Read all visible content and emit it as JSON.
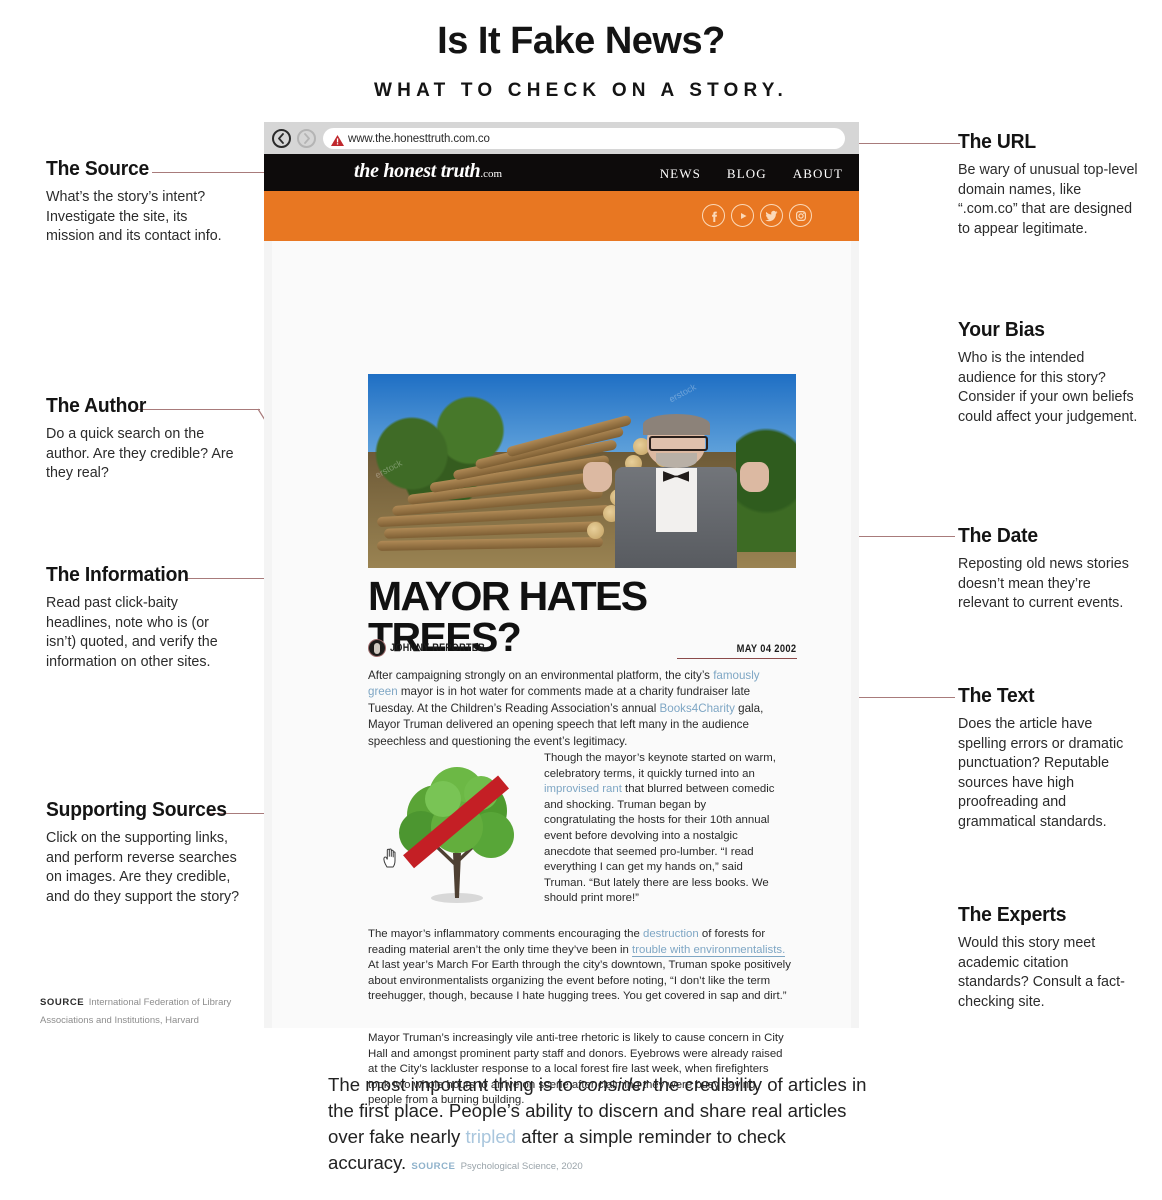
{
  "header": {
    "title": "Is It Fake News?",
    "subtitle": "WHAT TO CHECK ON A STORY."
  },
  "browser": {
    "url": "www.the.honesttruth.com.co",
    "back_icon": "back-arrow-icon",
    "forward_icon": "forward-arrow-icon",
    "warning_icon": "warning-triangle-icon",
    "site": {
      "logo": "the honest truth",
      "logo_suffix": ".com",
      "nav": [
        "NEWS",
        "BLOG",
        "ABOUT"
      ],
      "socials": [
        "facebook-icon",
        "youtube-icon",
        "twitter-icon",
        "instagram-icon"
      ]
    },
    "article": {
      "headline": "MAYOR HATES TREES?",
      "author": "JOHNNY REPORTER",
      "date": "MAY 04 2002",
      "lead_1": "After campaigning strongly on an environmental platform, the city’s ",
      "lead_link_1": "famously green",
      "lead_2": " mayor is in hot water for comments made at a charity fundraiser late Tuesday. At the Children’s Reading Association’s annual ",
      "lead_link_2": "Books4Charity",
      "lead_3": " gala, Mayor Truman delivered an opening speech that left many in the audience speechless and questioning the event’s legitimacy.",
      "col_1": "Though the mayor’s keynote started on warm, celebratory terms, it quickly turned into an ",
      "col_link": "improvised rant",
      "col_2": " that blurred between comedic and shocking. Truman began by congratulating the hosts for their 10th annual event before devolving into a nostalgic anecdote that seemed pro-lumber. “I read everything I can get my hands on,” said Truman. “But lately there are less books. We should print more!”",
      "p3_1": "The mayor’s inflammatory comments encouraging the ",
      "p3_link_1": "destruction",
      "p3_2": " of forests for reading material aren’t the only time they’ve been in ",
      "p3_link_2": "trouble with environmentalists.",
      "p3_3": " At last year’s March For Earth through the city’s downtown, Truman spoke positively about environmentalists organizing the event before noting, “I don’t like the term treehugger, though, because I hate hugging trees. You get covered in sap and dirt.”",
      "p4": "Mayor Truman’s increasingly vile anti-tree rhetoric is likely to cause concern in City Hall and amongst prominent party staff and donors. Eyebrows were already raised at the City’s lackluster response to a local forest fire last week, when firefighters took two whole hours to arrive on scene after claiming they were busy saving people from a burning building."
    }
  },
  "annotations_left": [
    {
      "title": "The Source",
      "body": "What’s the story’s intent? Investigate the site, its mission and its contact info."
    },
    {
      "title": "The Author",
      "body": "Do a quick search on the author. Are they credible? Are they real?"
    },
    {
      "title": "The Information",
      "body": "Read past click-baity headlines, note who is (or isn’t) quoted, and verify the information on other sites."
    },
    {
      "title": "Supporting Sources",
      "body": "Click on the supporting links, and perform reverse searches on images. Are they credible, and do they support the story?"
    }
  ],
  "annotations_right": [
    {
      "title": "The URL",
      "body": "Be wary of unusual top-level domain names, like “.com.co” that are designed to appear legitimate."
    },
    {
      "title": "Your Bias",
      "body": "Who is the intended audience for this story? Consider if your own beliefs could affect your judgement."
    },
    {
      "title": "The Date",
      "body": "Reposting old news stories doesn’t mean they’re relevant to current events."
    },
    {
      "title": "The Text",
      "body": "Does the article have spelling errors or dramatic punctuation? Reputable sources have high proofreading and grammatical standards."
    },
    {
      "title": "The Experts",
      "body": "Would this story meet academic citation standards? Consult a fact-checking site."
    }
  ],
  "source_note": {
    "label": "SOURCE",
    "value": "International Federation of Library Associations and Institutions, Harvard"
  },
  "footer": {
    "text_1": "The most important thing is to ",
    "italic": "consider",
    "text_2": " the credibility of articles in the first place. People’s ability to discern and share real articles over fake nearly ",
    "highlight": "tripled",
    "text_3": " after a simple reminder to check accuracy.",
    "source_label": "SOURCE",
    "source_value": "Psychological Science, 2020"
  },
  "colors": {
    "orange": "#e87722",
    "connector": "#a87b7b",
    "link_blue": "#7ea6c4",
    "black_bar": "#0d0b0b"
  }
}
